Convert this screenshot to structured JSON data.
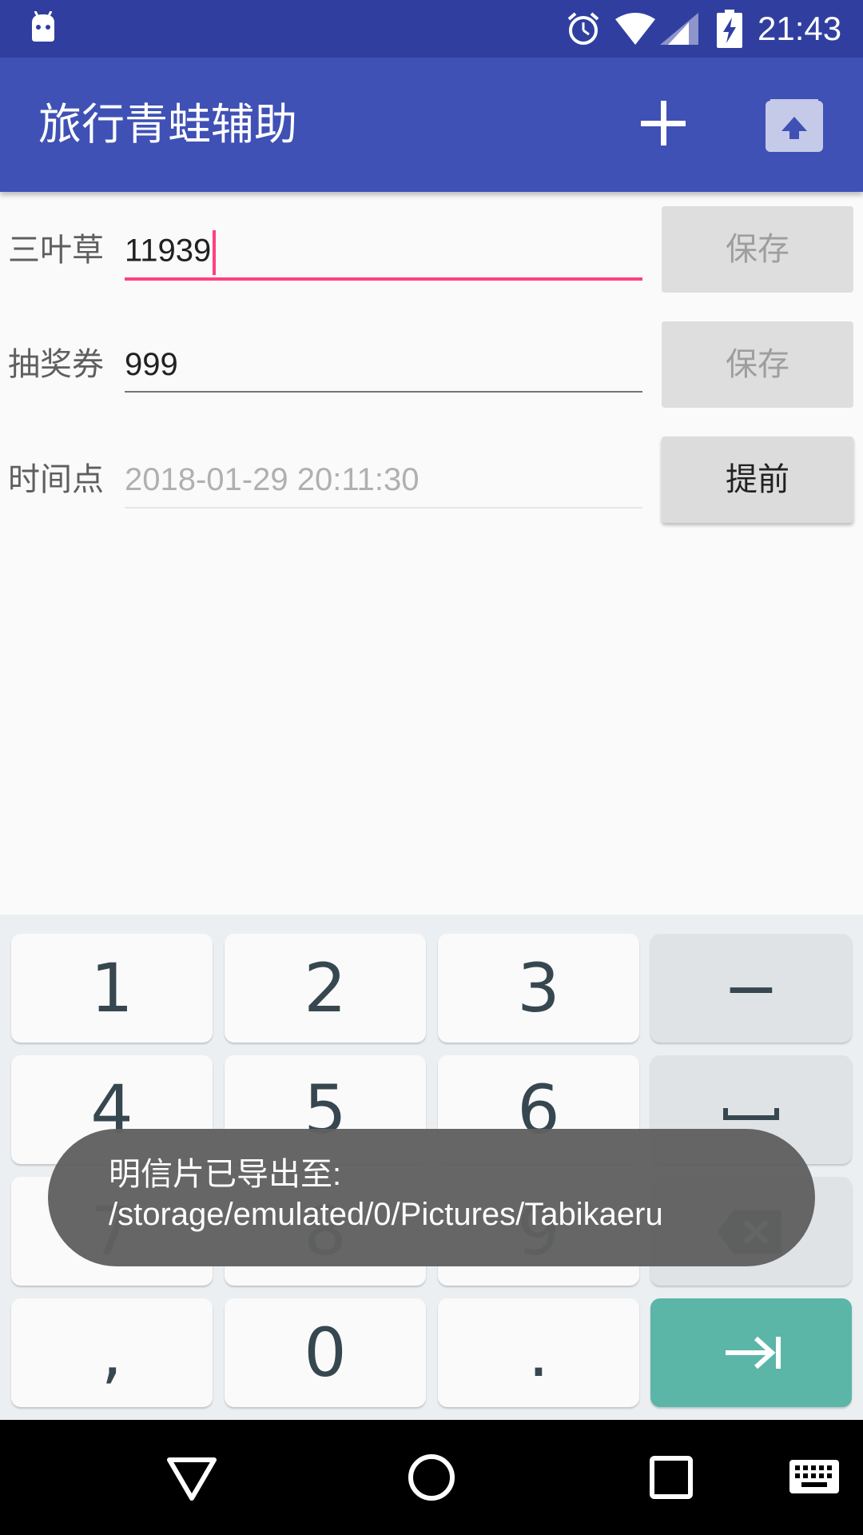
{
  "status_bar": {
    "time": "21:43"
  },
  "app_bar": {
    "title": "旅行青蛙辅助"
  },
  "form": {
    "clover": {
      "label": "三叶草",
      "value": "11939",
      "save_label": "保存"
    },
    "tickets": {
      "label": "抽奖券",
      "value": "999",
      "save_label": "保存"
    },
    "time_point": {
      "label": "时间点",
      "placeholder": "2018-01-29 20:11:30",
      "advance_label": "提前"
    }
  },
  "keyboard": {
    "keys": [
      "1",
      "2",
      "3",
      "−",
      "4",
      "5",
      "6",
      "␣",
      "7",
      "8",
      "9",
      "⌫",
      ",",
      "0",
      ".",
      "⇥"
    ]
  },
  "toast": {
    "message": "明信片已导出至: /storage/emulated/0/Pictures/Tabikaeru"
  },
  "colors": {
    "status_bar": "#303f9f",
    "app_bar": "#3f51b5",
    "accent": "#ff4081",
    "enter_key": "#5bb6a8"
  }
}
